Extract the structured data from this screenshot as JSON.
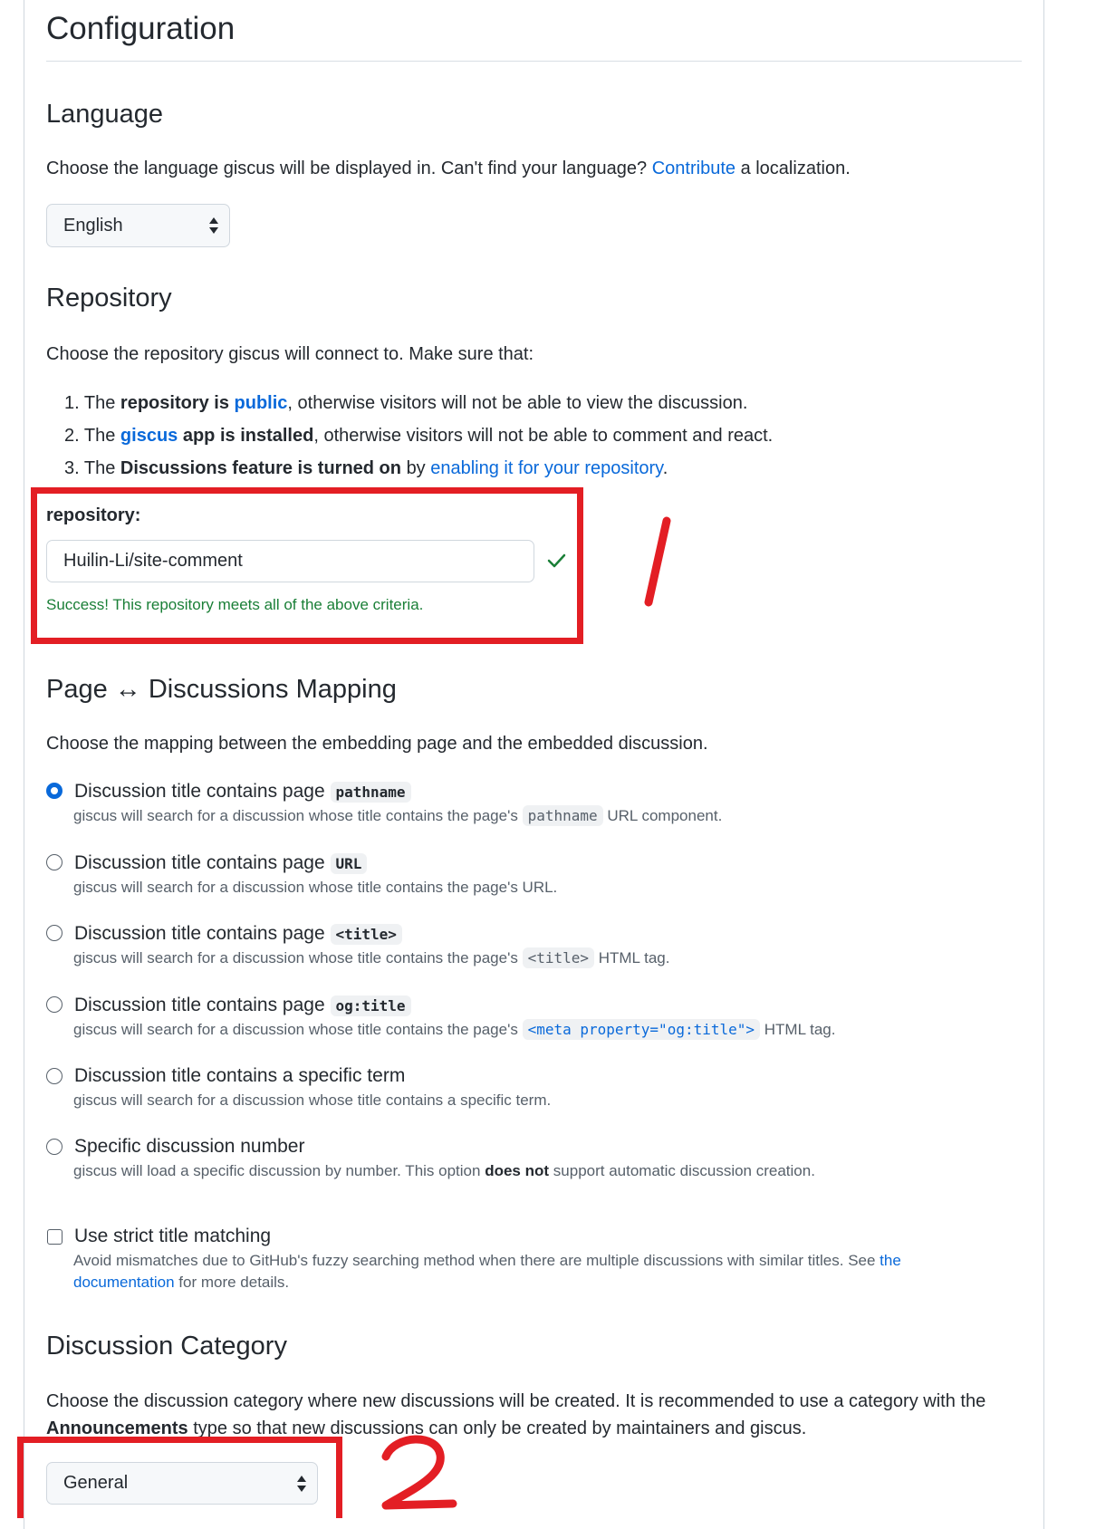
{
  "page": {
    "title": "Configuration"
  },
  "language": {
    "heading": "Language",
    "description_before": "Choose the language giscus will be displayed in. Can't find your language?",
    "contribute_link": "Contribute",
    "description_after": "a localization.",
    "selected": "English"
  },
  "repository": {
    "heading": "Repository",
    "intro": "Choose the repository giscus will connect to. Make sure that:",
    "criteria": [
      {
        "num": "1.",
        "pre": "The",
        "bold1": "repository is",
        "link": "public",
        "rest": ", otherwise visitors will not be able to view the discussion."
      },
      {
        "num": "2.",
        "pre": "The",
        "link": "giscus",
        "bold1": "app is installed",
        "rest": ", otherwise visitors will not be able to comment and react."
      },
      {
        "num": "3.",
        "pre": "The",
        "bold1": "Discussions feature is turned on",
        "mid": "by",
        "link": "enabling it for your repository",
        "rest": "."
      }
    ],
    "field_label": "repository:",
    "field_value": "Huilin-Li/site-comment",
    "success": "Success! This repository meets all of the above criteria.",
    "check_icon": "check-icon"
  },
  "mapping": {
    "heading": "Page ↔ Discussions Mapping",
    "intro": "Choose the mapping between the embedding page and the embedded discussion.",
    "options": [
      {
        "label": "Discussion title contains page",
        "code": "pathname",
        "desc_pre": "giscus will search for a discussion whose title contains the page's",
        "desc_code": "pathname",
        "desc_post": "URL component.",
        "checked": true
      },
      {
        "label": "Discussion title contains page",
        "code": "URL",
        "desc_pre": "giscus will search for a discussion whose title contains the page's URL.",
        "checked": false
      },
      {
        "label": "Discussion title contains page",
        "code": "<title>",
        "desc_pre": "giscus will search for a discussion whose title contains the page's",
        "desc_code": "<title>",
        "desc_post": "HTML tag.",
        "checked": false
      },
      {
        "label": "Discussion title contains page",
        "code": "og:title",
        "desc_pre": "giscus will search for a discussion whose title contains the page's",
        "desc_code": "<meta property=\"og:title\">",
        "desc_post": "HTML tag.",
        "checked": false
      },
      {
        "label": "Discussion title contains a specific term",
        "desc_pre": "giscus will search for a discussion whose title contains a specific term.",
        "checked": false
      },
      {
        "label": "Specific discussion number",
        "desc_pre": "giscus will load a specific discussion by number. This option",
        "desc_bold": "does not",
        "desc_post": "support automatic discussion creation.",
        "checked": false
      }
    ],
    "strict": {
      "label": "Use strict title matching",
      "desc_line1": "Avoid mismatches due to GitHub's fuzzy searching method when there are multiple discussions with similar titles. See",
      "link1": "the",
      "link2": "documentation",
      "desc_end": "for more details.",
      "checked": false
    }
  },
  "category": {
    "heading": "Discussion Category",
    "line1": "Choose the discussion category where new discussions will be created. It is recommended to use a category with the",
    "bold": "Announcements",
    "line2_rest": "type so that new discussions can only be created by maintainers and giscus.",
    "selected": "General"
  },
  "annotations": {
    "mark1": "1",
    "mark2": "2",
    "color": "#e31e24"
  }
}
